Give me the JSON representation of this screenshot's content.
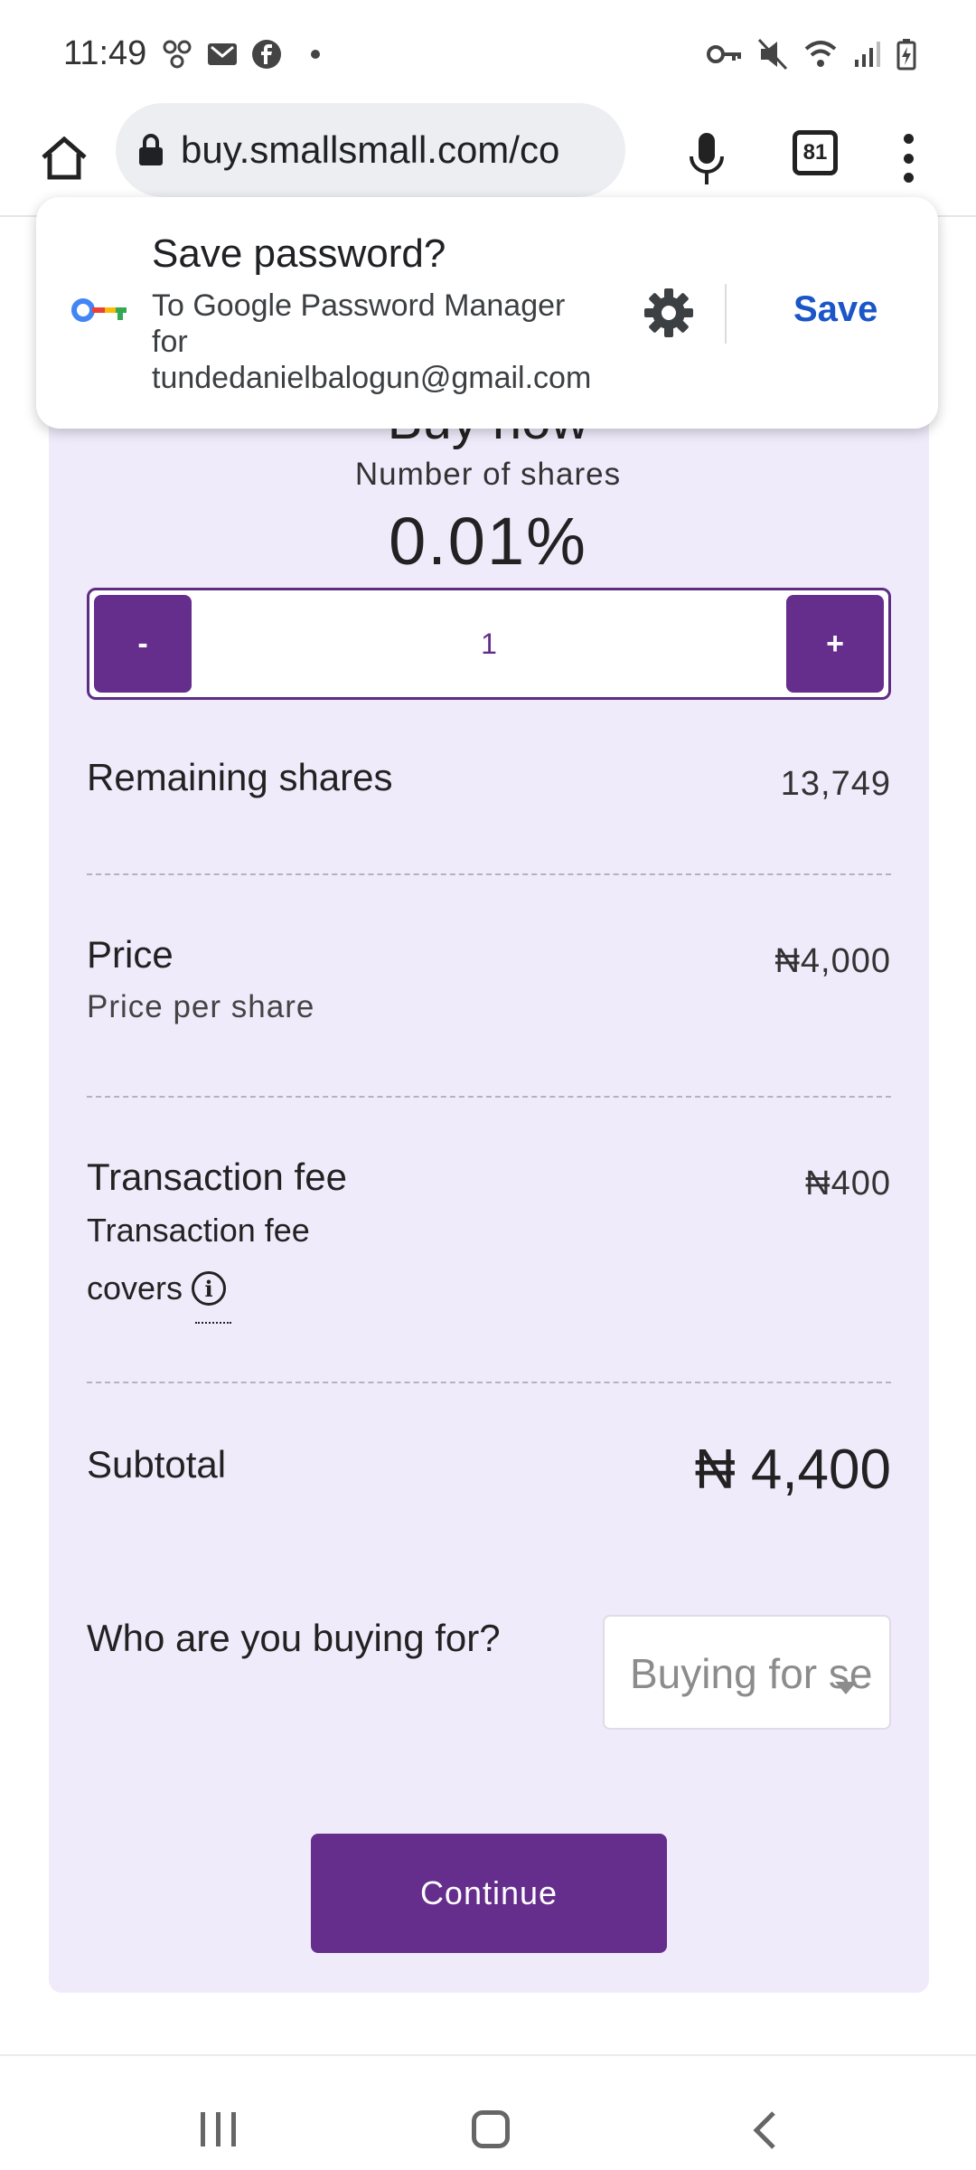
{
  "status_bar": {
    "time": "11:49",
    "battery_icon": "battery-charging-icon"
  },
  "browser": {
    "url": "buy.smallsmall.com/co",
    "tab_count": "81"
  },
  "password_prompt": {
    "title": "Save password?",
    "subtitle_line1": "To Google Password Manager",
    "subtitle_line2": "for",
    "subtitle_line3": "tundedanielbalogun@gmail.com",
    "save_label": "Save"
  },
  "buy_form": {
    "title": "Buy now",
    "shares_label": "Number of shares",
    "percent": "0.01%",
    "minus_label": "-",
    "plus_label": "+",
    "quantity": "1",
    "remaining_label": "Remaining shares",
    "remaining_value": "13,749",
    "price_label": "Price",
    "price_sub": "Price per share",
    "price_value": "₦4,000",
    "fee_label": "Transaction fee",
    "fee_sub1": "Transaction fee",
    "fee_sub2": "covers",
    "fee_value": "₦400",
    "subtotal_label": "Subtotal",
    "subtotal_value": "₦ 4,400",
    "buying_for_label": "Who are you buying for?",
    "buying_for_placeholder": "Buying for se",
    "continue_label": "Continue",
    "accent_color": "#652e8d",
    "card_color": "#f0ebfb"
  }
}
